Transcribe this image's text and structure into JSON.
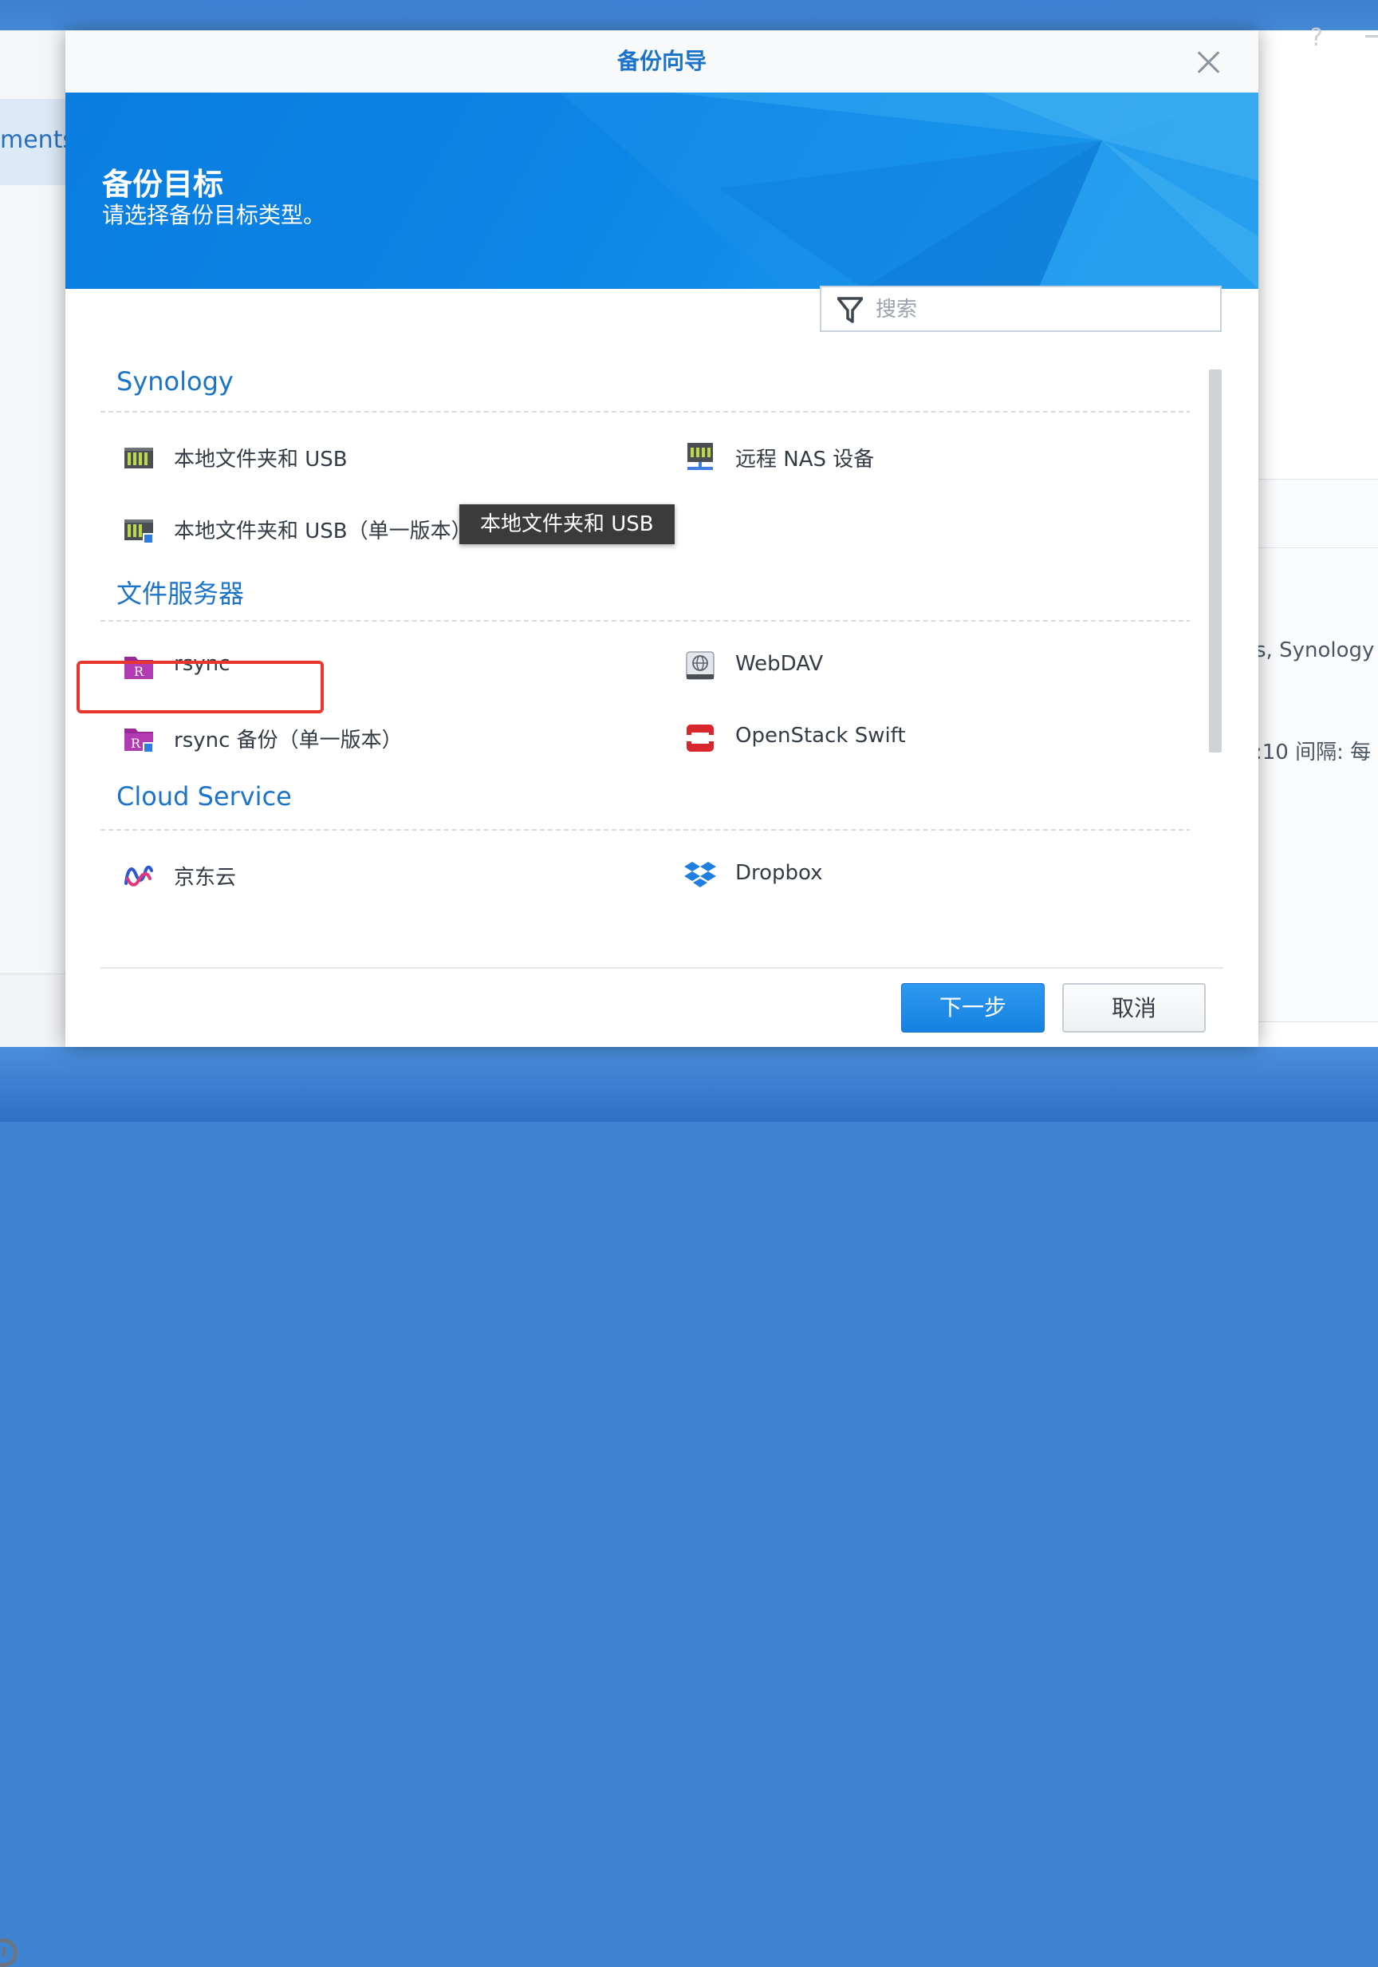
{
  "background": {
    "left_text": "ments",
    "right_text_1": "s, Synology",
    "right_text_2": ":10 间隔: 每"
  },
  "dialog": {
    "title": "备份向导",
    "banner": {
      "title": "备份目标",
      "subtitle": "请选择备份目标类型。"
    },
    "search": {
      "placeholder": "搜索",
      "value": ""
    },
    "groups": [
      {
        "title": "Synology",
        "items": [
          {
            "label": "本地文件夹和 USB",
            "icon": "local-storage-icon"
          },
          {
            "label": "远程 NAS 设备",
            "icon": "remote-nas-icon"
          },
          {
            "label": "本地文件夹和 USB（单一版本）",
            "icon": "local-storage-single-version-icon"
          }
        ]
      },
      {
        "title": "文件服务器",
        "items": [
          {
            "label": "rsync",
            "icon": "rsync-icon"
          },
          {
            "label": "WebDAV",
            "icon": "webdav-icon"
          },
          {
            "label": "rsync 备份（单一版本）",
            "icon": "rsync-single-version-icon"
          },
          {
            "label": "OpenStack Swift",
            "icon": "openstack-icon"
          }
        ]
      },
      {
        "title": "Cloud Service",
        "items": [
          {
            "label": "京东云",
            "icon": "jdcloud-icon"
          },
          {
            "label": "Dropbox",
            "icon": "dropbox-icon"
          }
        ]
      }
    ],
    "tooltip": "本地文件夹和 USB",
    "buttons": {
      "next": "下一步",
      "cancel": "取消"
    }
  },
  "colors": {
    "accent": "#1b74c9",
    "banner": "#0c86e6",
    "highlight": "#e8352d"
  }
}
